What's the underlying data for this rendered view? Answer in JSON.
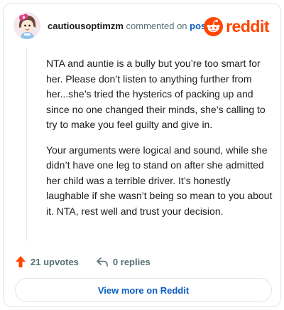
{
  "header": {
    "username": "cautiousoptimzm",
    "action_text": "commented on",
    "post_link": "post",
    "brand_name": "reddit",
    "brand_color": "#ff4500",
    "avatar_icon": "avatar-icon",
    "brand_icon": "reddit-snoo-icon"
  },
  "comment": {
    "paragraphs": [
      "NTA and auntie is a bully but you’re too smart for her. Please don’t listen to anything further from her...she’s tried the hysterics of packing up and since no one changed their minds, she’s calling to try to make you feel guilty and give in.",
      "Your arguments were logical and sound, while she didn’t have one leg to stand on after she admitted her child was a terrible driver. It’s honestly laughable if she wasn’t being so mean to you about it. NTA, rest well and trust your decision."
    ]
  },
  "actions": {
    "upvotes": "21 upvotes",
    "replies": "0 replies",
    "upvote_icon": "upvote-arrow-icon",
    "reply_icon": "reply-arrow-icon"
  },
  "footer": {
    "view_more": "View more on Reddit"
  },
  "colors": {
    "accent": "#ff4500",
    "link": "#0a5dc2",
    "muted": "#576f76",
    "border": "#e2e5e9"
  }
}
